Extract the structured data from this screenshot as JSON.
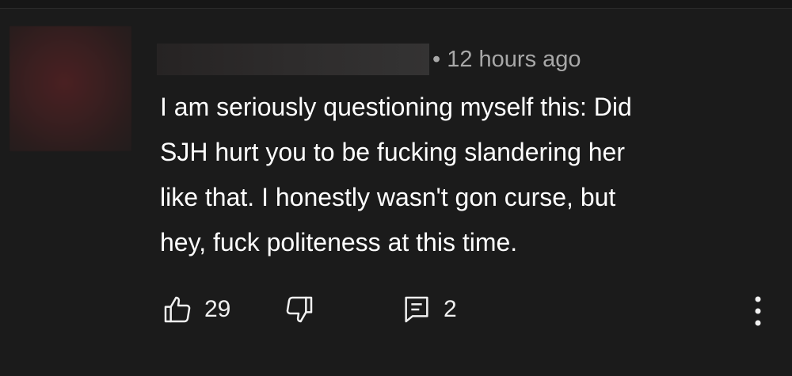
{
  "comment": {
    "timestamp": "• 12 hours ago",
    "text_lines": [
      "I am seriously questioning myself this: Did",
      "SJH hurt you to be fucking slandering her",
      "like that. I honestly wasn't gon curse, but",
      "hey, fuck politeness at this time."
    ],
    "likes": "29",
    "replies": "2"
  },
  "icons": {
    "like": "thumbs-up-icon",
    "dislike": "thumbs-down-icon",
    "reply": "comment-icon",
    "more": "more-vertical-icon"
  },
  "colors": {
    "background": "#1b1b1b",
    "text": "#ffffff",
    "secondary_text": "#a8a8a8"
  }
}
